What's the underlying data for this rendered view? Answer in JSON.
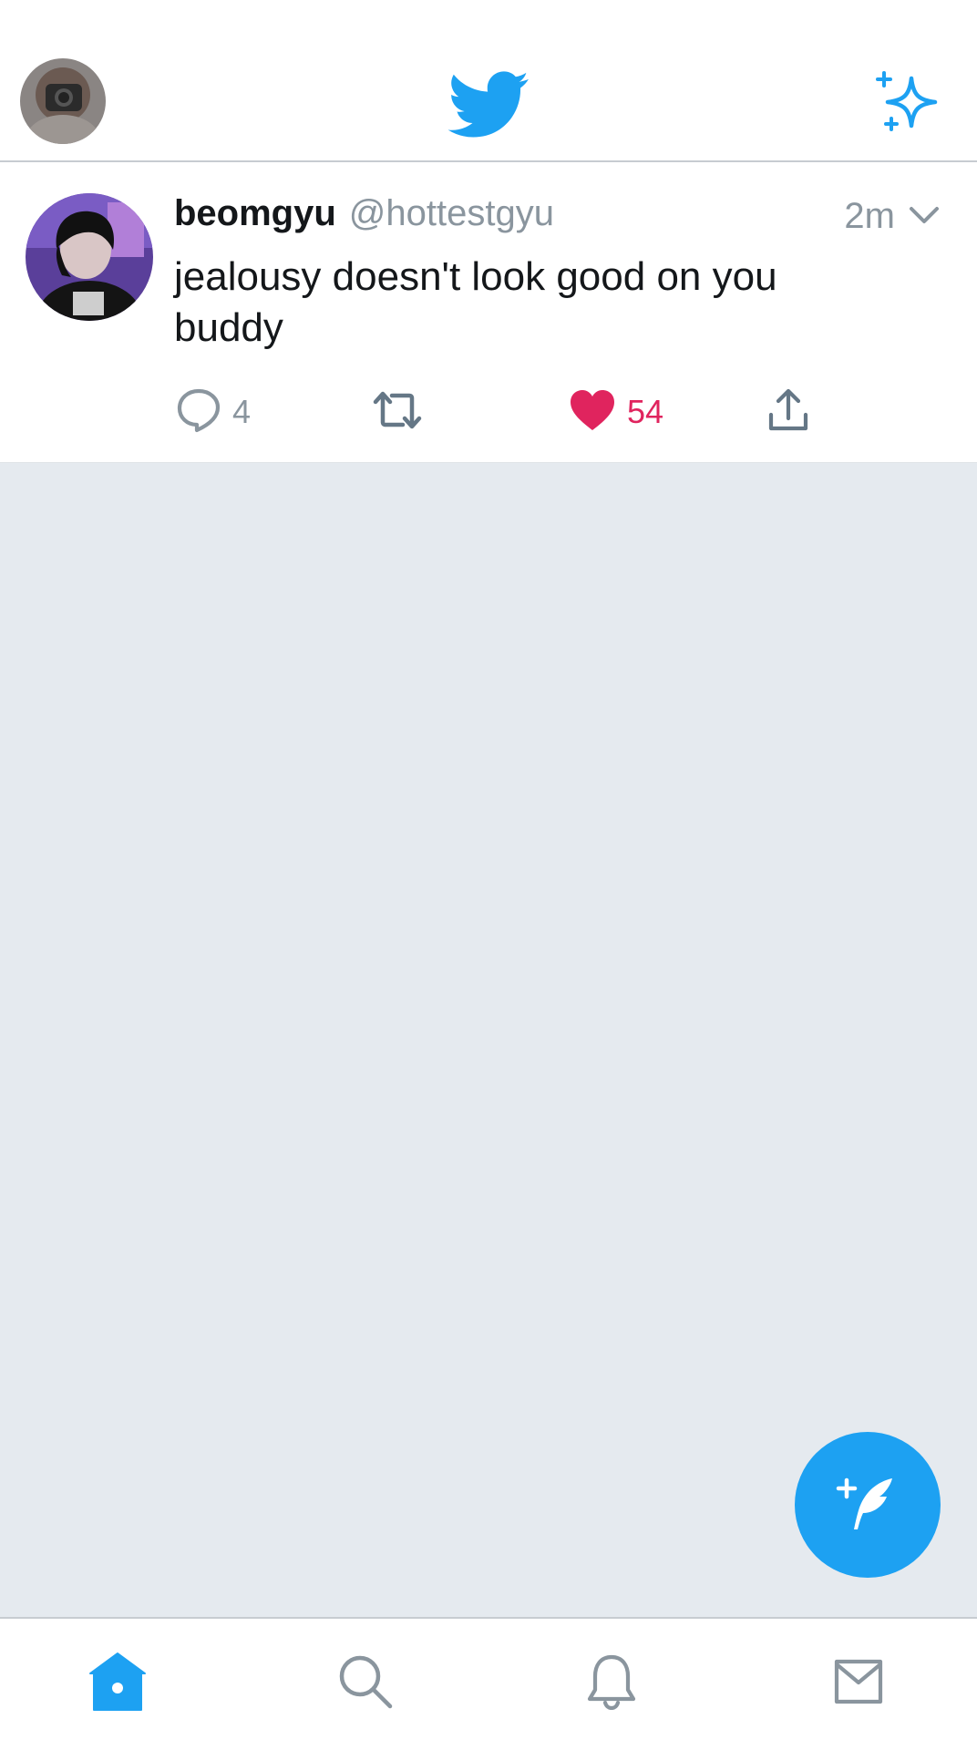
{
  "colors": {
    "accent": "#1da1f2",
    "like": "#e0245e",
    "secondary_text": "#8a959e",
    "primary_text": "#14171a",
    "timeline_bg": "#e5eaef"
  },
  "header": {
    "icons": [
      "profile-avatar",
      "twitter-bird-icon",
      "sparkle-icon"
    ]
  },
  "tweet": {
    "display_name": "beomgyu",
    "handle": "@hottestgyu",
    "time": "2m",
    "text": "jealousy doesn't look good on you buddy",
    "reply_count": "4",
    "like_count": "54",
    "liked": true
  },
  "tabbar": {
    "tabs": [
      "home",
      "search",
      "notifications",
      "messages"
    ],
    "active": "home"
  }
}
